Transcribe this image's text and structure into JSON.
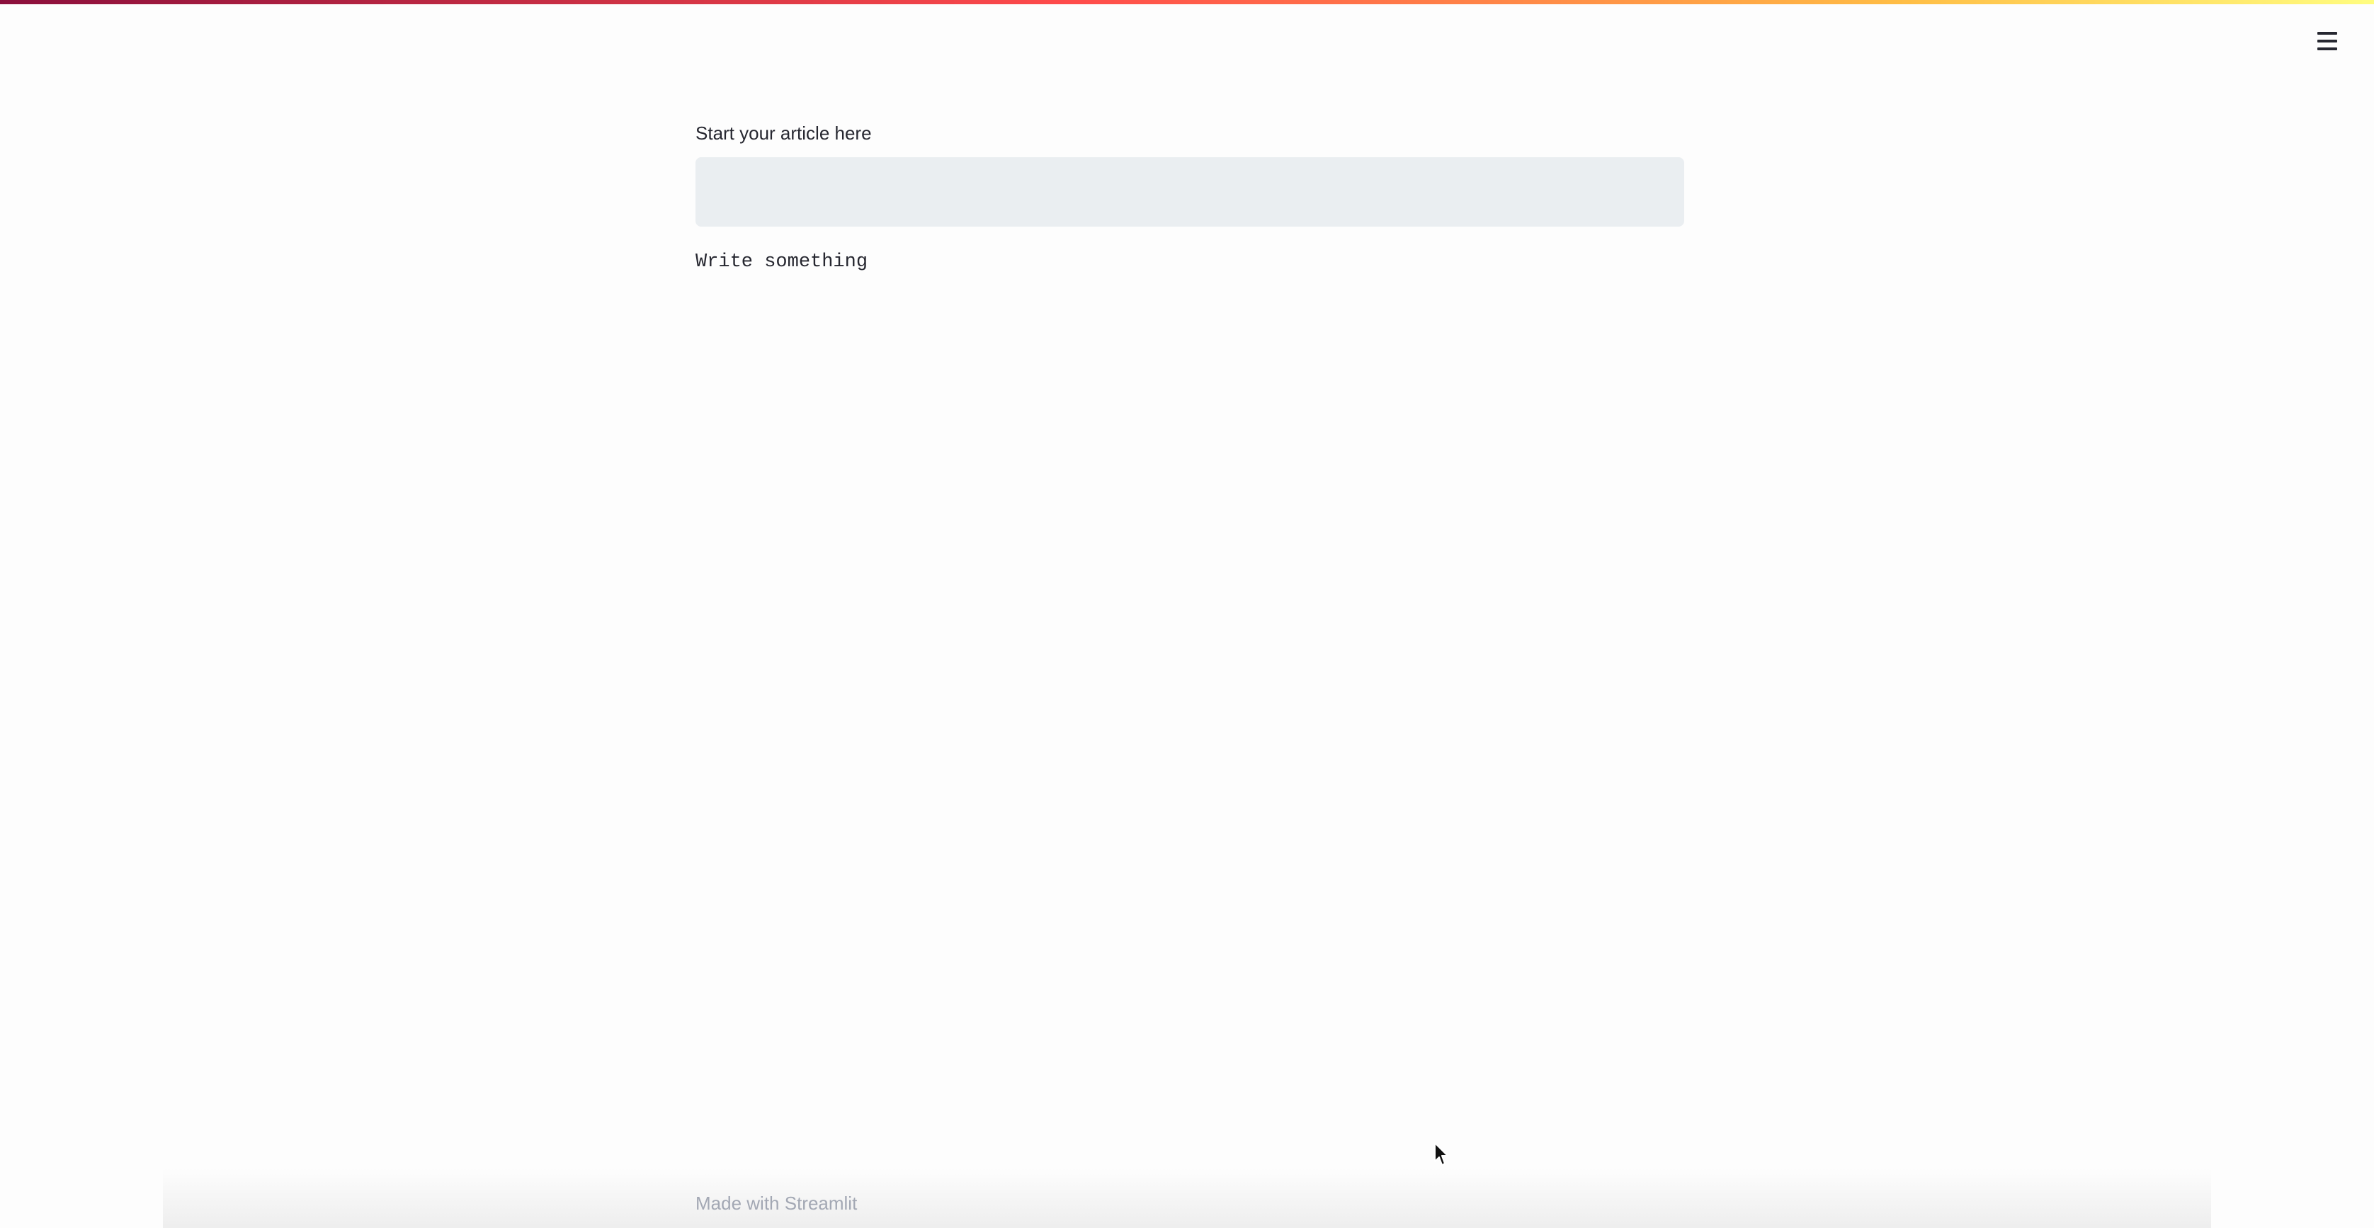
{
  "header": {
    "menu_icon": "hamburger-menu-icon"
  },
  "main": {
    "input_label": "Start your article here",
    "input_value": "",
    "input_placeholder": "",
    "output_text": "Write something"
  },
  "footer": {
    "text": "Made with Streamlit"
  },
  "colors": {
    "accent": "#ff4b4b",
    "input_background": "#eaeef1",
    "footer_text": "#a3a8b4"
  },
  "cursor": {
    "icon": "mouse-pointer-icon"
  }
}
